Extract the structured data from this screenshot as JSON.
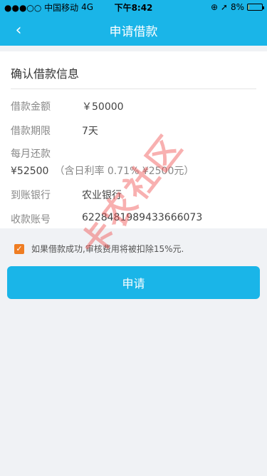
{
  "status_bar": {
    "carrier": "●●●○○ 中国移动",
    "network": "4G",
    "time": "下午8:42",
    "icons": "⊕ ➚",
    "battery_percent": "8%",
    "battery_level": 0.08
  },
  "nav": {
    "back_icon": "‹",
    "title": "申请借款"
  },
  "card": {
    "title": "确认借款信息",
    "amount_label": "借款金额",
    "amount_value": "￥50000",
    "term_label": "借款期限",
    "term_value": "7天",
    "monthly_label": "每月还款",
    "monthly_value": "¥52500",
    "monthly_note": "（含日利率 0.71% ¥2500元）",
    "bank_label": "到账银行",
    "bank_value": "农业银行",
    "account_label": "收款账号",
    "account_value": "6228481989433666073"
  },
  "agreement": {
    "checked_mark": "✓",
    "text": "如果借款成功,审核费用将被扣除15%元."
  },
  "apply_button": "申请",
  "watermark": "卡农社区",
  "colors": {
    "primary": "#1ab5e8",
    "checkbox": "#ef7d23",
    "watermark": "#f05050"
  }
}
